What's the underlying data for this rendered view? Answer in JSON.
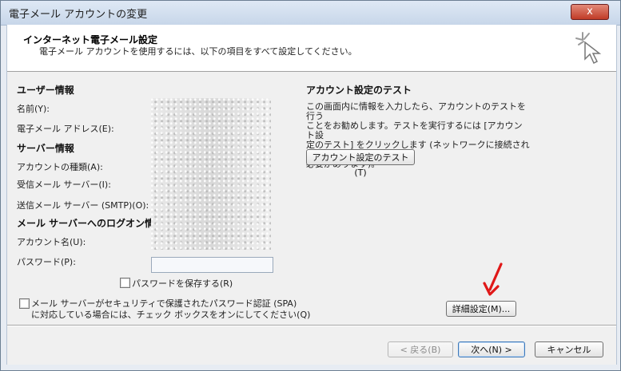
{
  "window": {
    "title": "電子メール アカウントの変更",
    "close_label": "x"
  },
  "header": {
    "title": "インターネット電子メール設定",
    "subtitle": "電子メール アカウントを使用するには、以下の項目をすべて設定してください。"
  },
  "user_info": {
    "heading": "ユーザー情報",
    "name_label": "名前(Y):",
    "email_label": "電子メール アドレス(E):"
  },
  "server_info": {
    "heading": "サーバー情報",
    "account_type_label": "アカウントの種類(A):",
    "incoming_label": "受信メール サーバー(I):",
    "outgoing_label": "送信メール サーバー (SMTP)(O):"
  },
  "logon_info": {
    "heading": "メール サーバーへのログオン情報",
    "account_name_label": "アカウント名(U):",
    "password_label": "パスワード(P):",
    "password_value": "",
    "save_password_label": "パスワードを保存する(R)"
  },
  "spa": {
    "label_line1": "メール サーバーがセキュリティで保護されたパスワード認証 (SPA)",
    "label_line2": "に対応している場合には、チェック ボックスをオンにしてください(Q)"
  },
  "test": {
    "heading": "アカウント設定のテスト",
    "line1": "この画面内に情報を入力したら、アカウントのテストを行う",
    "line2": "ことをお勧めします。テストを実行するには [アカウント設",
    "line3": "定のテスト] をクリックします (ネットワークに接続されている",
    "line4": "必要があります)。",
    "button_label": "アカウント設定のテスト(T)"
  },
  "buttons": {
    "advanced": "詳細設定(M)...",
    "back": "< 戻る(B)",
    "next": "次へ(N) >",
    "cancel": "キャンセル"
  },
  "colors": {
    "arrow_annotation": "#e01818"
  }
}
